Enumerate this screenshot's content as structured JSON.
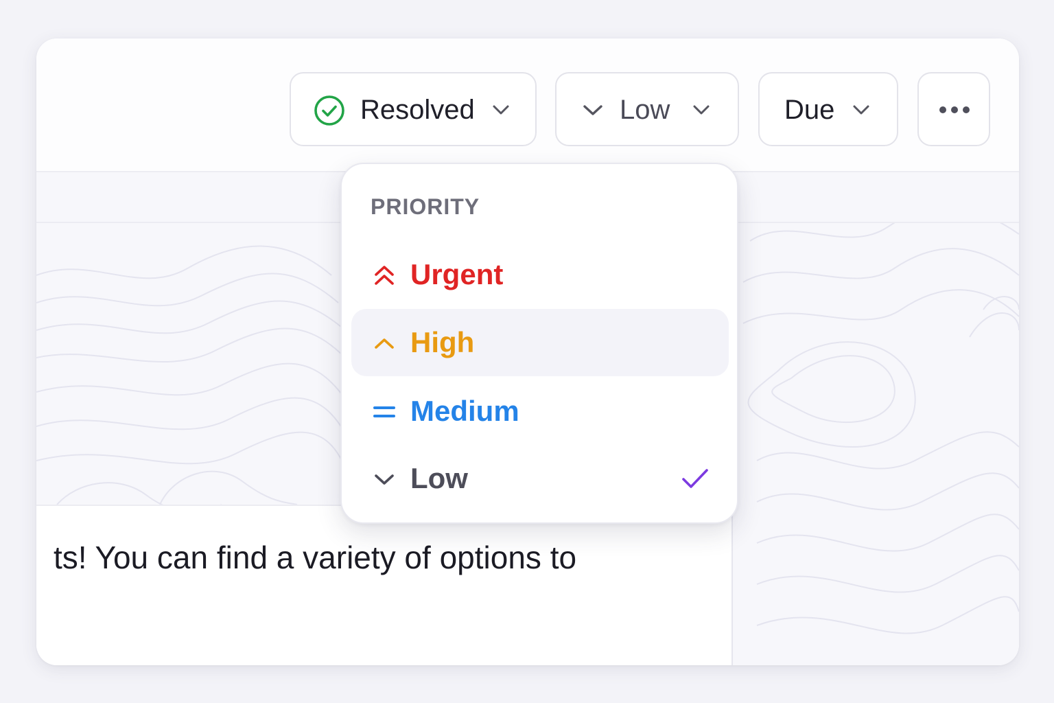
{
  "toolbar": {
    "status": {
      "label": "Resolved",
      "icon": "check-circle-icon",
      "color": "#22a447"
    },
    "priority": {
      "label": "Low",
      "icon": "chevron-down-icon"
    },
    "due": {
      "label": "Due"
    },
    "more": {
      "icon": "more-horizontal-icon"
    }
  },
  "priority_menu": {
    "heading": "PRIORITY",
    "items": [
      {
        "label": "Urgent",
        "icon": "double-chevron-up-icon",
        "color": "#e02424"
      },
      {
        "label": "High",
        "icon": "chevron-up-icon",
        "color": "#e89a12",
        "highlighted": true
      },
      {
        "label": "Medium",
        "icon": "equals-icon",
        "color": "#2483e8"
      },
      {
        "label": "Low",
        "icon": "chevron-down-icon",
        "color": "#4d4d59",
        "selected": true
      }
    ],
    "selected_check_color": "#7c3ae0"
  },
  "editor": {
    "text": "ts! You can find a variety of options to"
  }
}
